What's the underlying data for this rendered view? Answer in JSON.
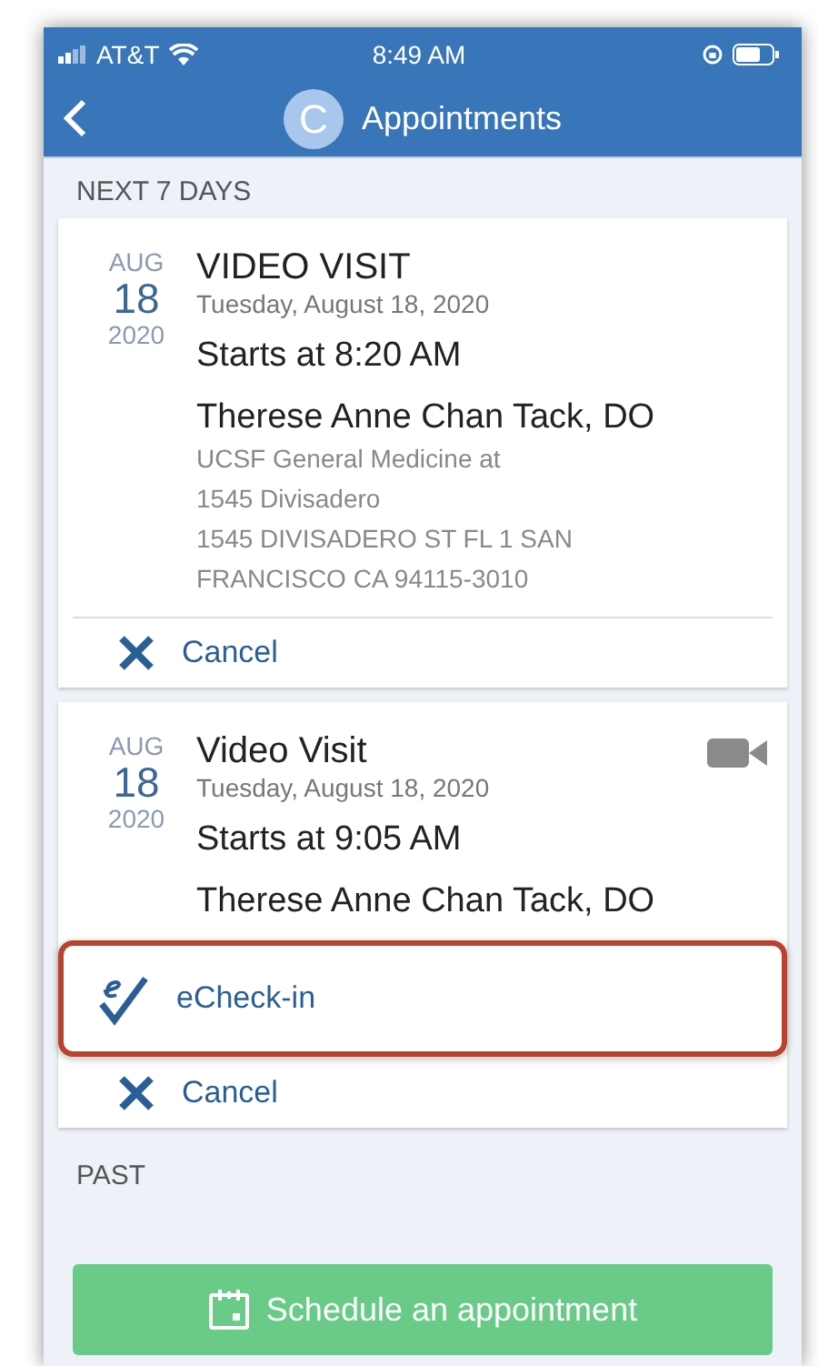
{
  "status_bar": {
    "carrier": "AT&T",
    "time": "8:49 AM"
  },
  "header": {
    "avatar": "C",
    "title": "Appointments"
  },
  "sections": [
    {
      "heading": "NEXT 7 DAYS",
      "appointments": [
        {
          "month": "AUG",
          "day": "18",
          "year": "2020",
          "title": "VIDEO VISIT",
          "date": "Tuesday, August 18, 2020",
          "start": "Starts at 8:20 AM",
          "provider": "Therese Anne Chan Tack, DO",
          "location": [
            "UCSF General Medicine at",
            "1545 Divisadero",
            "1545 DIVISADERO ST FL 1 SAN",
            "FRANCISCO CA 94115-3010"
          ],
          "video": false,
          "actions": [
            {
              "kind": "cancel",
              "label": "Cancel",
              "highlighted": false
            }
          ]
        },
        {
          "month": "AUG",
          "day": "18",
          "year": "2020",
          "title": "Video Visit",
          "date": "Tuesday, August 18, 2020",
          "start": "Starts at 9:05 AM",
          "provider": "Therese Anne Chan Tack, DO",
          "video": true,
          "actions": [
            {
              "kind": "echeck",
              "label": "eCheck-in",
              "highlighted": true
            },
            {
              "kind": "cancel",
              "label": "Cancel",
              "highlighted": false
            }
          ]
        }
      ]
    },
    {
      "heading": "PAST"
    }
  ],
  "schedule_button": "Schedule an appointment"
}
